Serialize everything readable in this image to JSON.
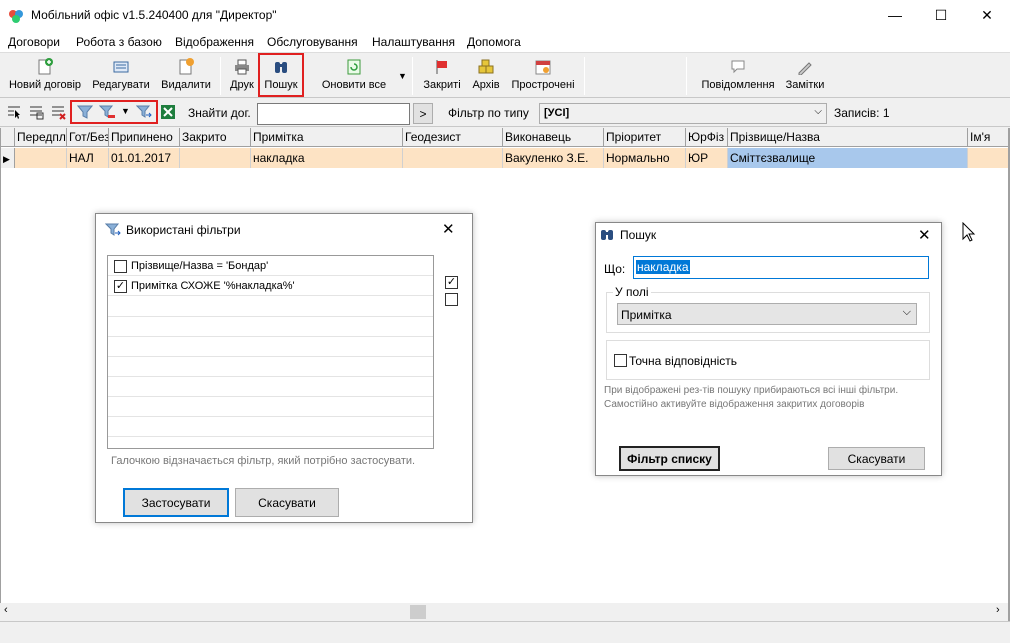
{
  "window": {
    "title": "Мобільний офіс v1.5.240400 для \"Директор\"",
    "minimize": "—",
    "maximize": "☐",
    "close": "✕"
  },
  "menu": [
    "Договори",
    "Робота з базою",
    "Відображення",
    "Обслуговування",
    "Налаштування",
    "Допомога"
  ],
  "toolbar": {
    "new": "Новий договір",
    "edit": "Редагувати",
    "delete": "Видалити",
    "print": "Друк",
    "search": "Пошук",
    "refresh": "Оновити все",
    "closed": "Закриті",
    "archive": "Архів",
    "overdue": "Прострочені",
    "notifications": "Повідомлення",
    "notes": "Замітки"
  },
  "filterbar": {
    "find_label": "Знайти дог.",
    "find_value": "",
    "go_button": ">",
    "type_label": "Фільтр по типу",
    "type_value": "[УСІ]",
    "records": "Записів: 1"
  },
  "grid": {
    "columns": [
      "Передпл",
      "Гот/Без",
      "Припинено",
      "Закрито",
      "Примітка",
      "Геодезист",
      "Виконавець",
      "Пріоритет",
      "ЮрФіз",
      "Прізвище/Назва",
      "Ім'я"
    ],
    "rows": [
      {
        "prepaid": "",
        "ready": "НАЛ",
        "stopped": "01.01.2017",
        "closed": "",
        "note": "накладка",
        "geodesist": "",
        "executor": "Вакуленко З.Е.",
        "priority": "Нормально",
        "legal": "ЮР",
        "name": "Сміттєзвалище",
        "firstname": ""
      }
    ]
  },
  "filters_dialog": {
    "title": "Використані фільтри",
    "items": [
      {
        "label": "Прізвище/Назва = 'Бондар'",
        "checked": false
      },
      {
        "label": "Примітка СХОЖЕ '%накладка%'",
        "checked": true
      }
    ],
    "hint": "Галочкою відзначається фільтр, який потрібно застосувати.",
    "apply": "Застосувати",
    "cancel": "Скасувати"
  },
  "search_dialog": {
    "title": "Пошук",
    "what_label": "Що:",
    "what_value": "накладка",
    "field_group": "У полі",
    "field_value": "Примітка",
    "exact_label": "Точна відповідність",
    "exact_checked": false,
    "note": "При відображені рез-тів пошуку прибираються всі інші фільтри. Самостійно активуйте відображення закритих договорів",
    "filter_button": "Фільтр списку",
    "cancel": "Скасувати"
  },
  "colors": {
    "row_highlight": "#fde3c4",
    "selected_cell": "#a8c8ec",
    "accent_blue": "#0078d7",
    "red_marker": "#e02020"
  }
}
